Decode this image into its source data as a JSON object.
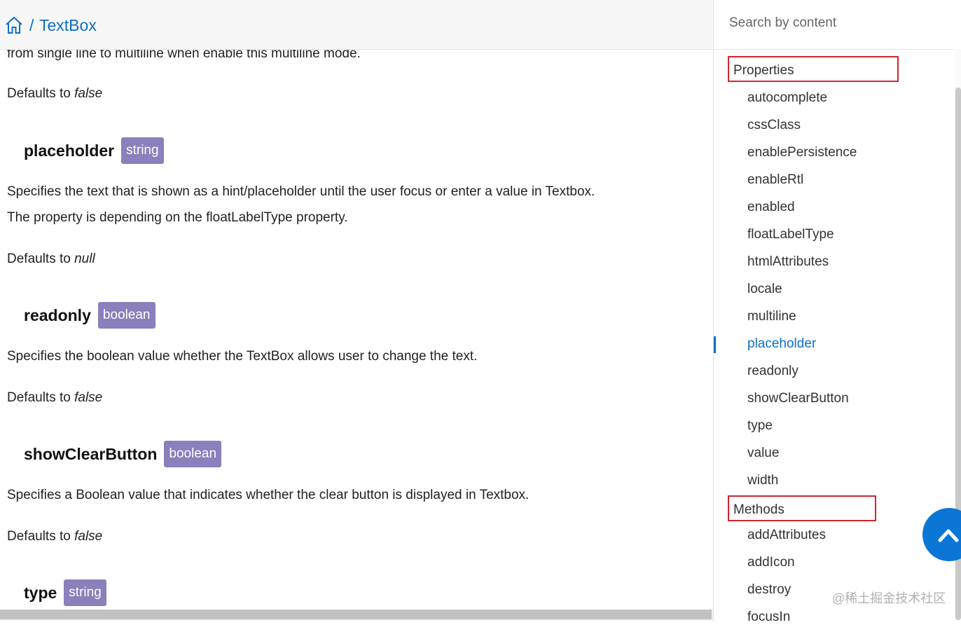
{
  "breadcrumb": {
    "separator": "/",
    "current": "TextBox"
  },
  "content": {
    "intro_tail": "from single line to multiline when enable this multiline mode.",
    "defaults_prefix": "Defaults to",
    "multiline_default": "false",
    "placeholder": {
      "name": "placeholder",
      "type": "string",
      "desc1": "Specifies the text that is shown as a hint/placeholder until the user focus or enter a value in Textbox.",
      "desc2": "The property is depending on the floatLabelType property.",
      "default": "null"
    },
    "readonly": {
      "name": "readonly",
      "type": "boolean",
      "desc1": "Specifies the boolean value whether the TextBox allows user to change the text.",
      "default": "false"
    },
    "showClearButton": {
      "name": "showClearButton",
      "type": "boolean",
      "desc1": "Specifies a Boolean value that indicates whether the clear button is displayed in Textbox.",
      "default": "false"
    },
    "type": {
      "name": "type",
      "type": "string"
    }
  },
  "sidebar": {
    "search_placeholder": "Search by content",
    "properties_label": "Properties",
    "properties": [
      "autocomplete",
      "cssClass",
      "enablePersistence",
      "enableRtl",
      "enabled",
      "floatLabelType",
      "htmlAttributes",
      "locale",
      "multiline",
      "placeholder",
      "readonly",
      "showClearButton",
      "type",
      "value",
      "width"
    ],
    "active_item": "placeholder",
    "methods_label": "Methods",
    "methods": [
      "addAttributes",
      "addIcon",
      "destroy",
      "focusIn"
    ]
  },
  "watermark": "@稀土掘金技术社区",
  "colors": {
    "accent": "#0b6fc9",
    "badge": "#8b7fbc",
    "highlight_box": "#d0252e"
  }
}
